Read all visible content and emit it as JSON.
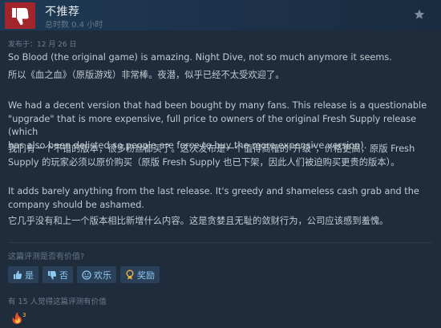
{
  "header": {
    "rating": "不推荐",
    "hours": "总时数 0.4 小时"
  },
  "review": {
    "posted": "发布于：12 月 26 日",
    "p1": "So Blood (the original game) is amazing. Night Dive, not so much anymore it seems.",
    "p2": "所以《血之血》（原版游戏）非常棒。夜潜，似乎已经不太受欢迎了。",
    "p3_l1": "We had a decent version that had been bought by many fans. This release is a questionable",
    "p3_l2": "\"upgrade\" that is more expensive, full price to owners of the original Fresh Supply release (which",
    "p3_l3": "has also been delisted so people are force to buy the more expensive version).",
    "p4_l1": "我们有一个不错的版本，很多粉丝都买了。这次发布是一个值得商榷的\"升级\"，价格更高，原版 Fresh",
    "p4_l2": "Supply 的玩家必须以原价购买（原版 Fresh Supply 也已下架，因此人们被迫购买更贵的版本）。",
    "p5_l1": "It adds barely anything from the last release. It's greedy and shameless cash grab and the",
    "p5_l2": "company should be ashamed.",
    "p6": "它几乎没有和上一个版本相比新增什么内容。这是贪婪且无耻的敛财行为，公司应该感到羞愧。"
  },
  "helpful": {
    "question": "这篇评测是否有价值?",
    "yes": "是",
    "no": "否",
    "funny": "欢乐",
    "award": "奖励",
    "found": "有 15 人觉得这篇评测有价值"
  },
  "colors": {
    "thumb_bg": "#a1252a",
    "button_bg": "#2a4059",
    "button_text": "#8fc8ef"
  }
}
